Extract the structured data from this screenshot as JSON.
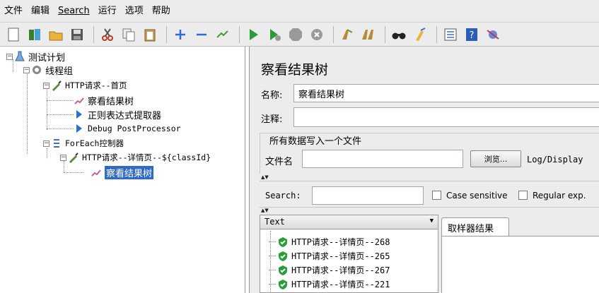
{
  "menu": {
    "items": [
      "文件",
      "编辑",
      "Search",
      "运行",
      "选项",
      "帮助"
    ]
  },
  "toolbar": {
    "icons": [
      "new-icon",
      "templates-icon",
      "open-icon",
      "save-icon",
      "cut-icon",
      "copy-icon",
      "paste-icon",
      "expand-icon",
      "collapse-icon",
      "toggle-icon",
      "start-icon",
      "start-no-pause-icon",
      "stop-icon",
      "shutdown-icon",
      "clear-icon",
      "clear-all-icon",
      "search-icon",
      "reset-search-icon",
      "function-helper-icon",
      "help-icon",
      "remote-icon"
    ]
  },
  "tree": {
    "test_plan": "测试计划",
    "thread_group": "线程组",
    "http_home": "HTTP请求--首页",
    "view_results_1": "察看结果树",
    "regex_extractor": "正则表达式提取器",
    "debug_post": "Debug PostProcessor",
    "foreach": "ForEach控制器",
    "http_detail": "HTTP请求--详情页--${classId}",
    "view_results_2": "察看结果树"
  },
  "panel": {
    "title": "察看结果树",
    "name_label": "名称:",
    "name_value": "察看结果树",
    "comment_label": "注释:",
    "comment_value": "",
    "file_group_title": "所有数据写入一个文件",
    "filename_label": "文件名",
    "filename_value": "",
    "browse_button": "浏览...",
    "log_display": "Log/Display",
    "search_label": "Search:",
    "search_value": "",
    "case_sensitive": "Case sensitive",
    "regular_exp": "Regular exp."
  },
  "results": {
    "renderer": "Text",
    "items": [
      "HTTP请求--详情页--268",
      "HTTP请求--详情页--265",
      "HTTP请求--详情页--267",
      "HTTP请求--详情页--221"
    ],
    "tab": "取样器结果"
  },
  "colors": {
    "selection": "#316ac5",
    "success": "#2a9d3a",
    "background": "#ececec"
  }
}
